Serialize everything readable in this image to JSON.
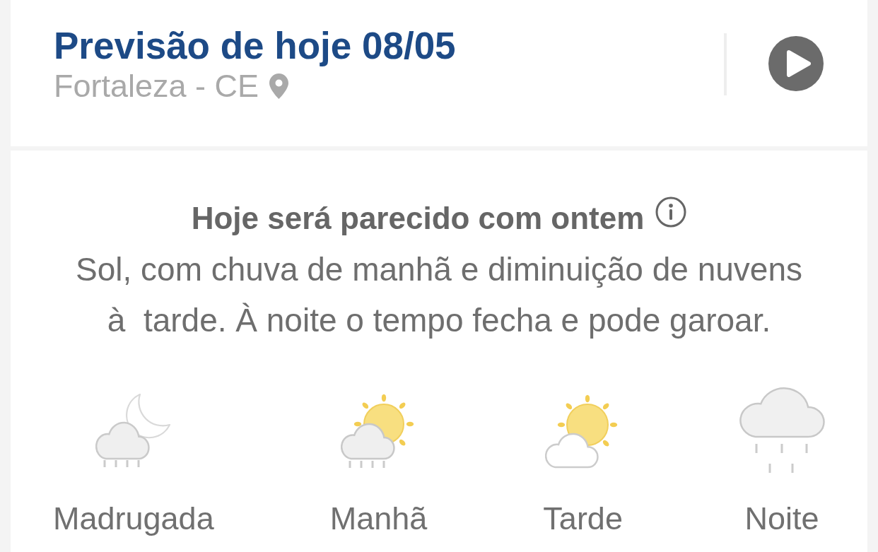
{
  "header": {
    "title": "Previsão de hoje 08/05",
    "location": "Fortaleza - CE"
  },
  "summary": {
    "heading": "Hoje será parecido com ontem",
    "description": "Sol, com chuva de manhã e diminuição de nuvens à  tarde. À noite o tempo fecha e pode garoar."
  },
  "periods": [
    {
      "label": "Madrugada",
      "kind": "moon_cloud_rain"
    },
    {
      "label": "Manhã",
      "kind": "sun_cloud_rain"
    },
    {
      "label": "Tarde",
      "kind": "sun_cloud"
    },
    {
      "label": "Noite",
      "kind": "cloud_rain"
    }
  ]
}
